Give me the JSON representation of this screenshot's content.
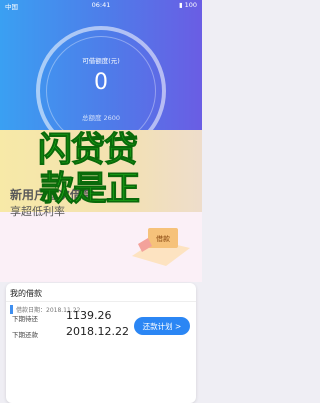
{
  "status_bar": {
    "left": "中国",
    "time": "06:41",
    "right": "▮ 100"
  },
  "credit": {
    "label": "可借额度(元)",
    "value": "0",
    "total_label": "总额度 2600"
  },
  "promo": {
    "line1": "闪贷贷",
    "line2": "款是正"
  },
  "banner": {
    "title": "新用户首次借款",
    "subtitle": "享超低利率",
    "badge_text": "借款"
  },
  "loan_card": {
    "title": "我的借款",
    "loan_date": "借款日期：2018.11.22",
    "rows": [
      {
        "label": "下期待还",
        "value": "1139.26"
      },
      {
        "label": "下期还款",
        "value": "2018.12.22"
      }
    ],
    "button_label": "还款计划 >"
  },
  "colors": {
    "header_start": "#3aa0f2",
    "header_end": "#6a5de4",
    "promo_green": "#21c21c",
    "button_blue": "#2b86f4"
  }
}
